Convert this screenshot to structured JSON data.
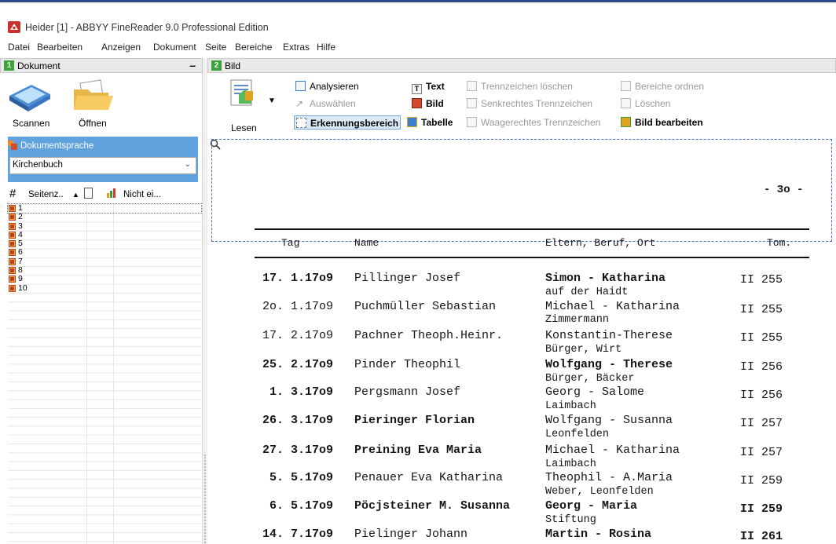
{
  "window": {
    "title": "Heider [1] - ABBYY FineReader 9.0 Professional Edition"
  },
  "menu": [
    "Datei",
    "Bearbeiten",
    "Anzeigen",
    "Dokument",
    "Seite",
    "Bereiche",
    "Extras",
    "Hilfe"
  ],
  "left_panel": {
    "number": "1",
    "title": "Dokument",
    "minimize": "–",
    "scan_label": "Scannen",
    "open_label": "Öffnen",
    "language_title": "Dokumentsprache",
    "language_value": "Kirchenbuch",
    "columns": {
      "pages": "Seitenz..",
      "status": "Nicht ei..."
    },
    "pages": [
      "1",
      "2",
      "3",
      "4",
      "5",
      "6",
      "7",
      "8",
      "9",
      "10"
    ]
  },
  "right_panel": {
    "number": "2",
    "title": "Bild",
    "read_label": "Lesen",
    "tools": {
      "analyze": "Analysieren",
      "select": "Auswählen",
      "recognition_area": "Erkennungsbereich",
      "text": "Text",
      "image": "Bild",
      "table": "Tabelle",
      "del_separator": "Trennzeichen löschen",
      "vertical_separator": "Senkrechtes Trennzeichen",
      "horizontal_separator": "Waagerechtes Trennzeichen",
      "order_areas": "Bereiche ordnen",
      "delete": "Löschen",
      "edit_image": "Bild bearbeiten"
    }
  },
  "document": {
    "page_number": "- 3o -",
    "headers": {
      "day": "Tag",
      "name": "Name",
      "parents": "Eltern, Beruf, Ort",
      "tome": "Tom."
    },
    "rows": [
      {
        "date": "17. 1.17o9",
        "name": "Pillinger Josef",
        "parents": "Simon - Katharina",
        "place": "auf der Haidt",
        "tome": "II 255"
      },
      {
        "date": "2o. 1.17o9",
        "name": "Puchmüller Sebastian",
        "parents": "Michael - Katharina",
        "place": "Zimmermann",
        "tome": "II 255"
      },
      {
        "date": "17. 2.17o9",
        "name": "Pachner Theoph.Heinr.",
        "parents": "Konstantin-Therese",
        "place": "Bürger, Wirt",
        "tome": "II 255"
      },
      {
        "date": "25. 2.17o9",
        "name": "Pinder Theophil",
        "parents": "Wolfgang - Therese",
        "place": "Bürger, Bäcker",
        "tome": "II 256"
      },
      {
        "date": " 1. 3.17o9",
        "name": "Pergsmann Josef",
        "parents": "Georg - Salome",
        "place": "Laimbach",
        "tome": "II 256"
      },
      {
        "date": "26. 3.17o9",
        "name": "Pieringer Florian",
        "parents": "Wolfgang - Susanna",
        "place": "Leonfelden",
        "tome": "II 257"
      },
      {
        "date": "27. 3.17o9",
        "name": "Preining Eva Maria",
        "parents": "Michael - Katharina",
        "place": "Laimbach",
        "tome": "II 257"
      },
      {
        "date": " 5. 5.17o9",
        "name": "Penauer Eva Katharina",
        "parents": "Theophil - A.Maria",
        "place": "Weber, Leonfelden",
        "tome": "II 259"
      },
      {
        "date": " 6. 5.17o9",
        "name": "Pöcjsteiner M. Susanna",
        "parents": "Georg - Maria",
        "place": "Stiftung",
        "tome": "II 259"
      },
      {
        "date": "14. 7.17o9",
        "name": "Pielinger Johann",
        "parents": "Martin - Rosina",
        "place": "",
        "tome": "II 261"
      }
    ]
  }
}
